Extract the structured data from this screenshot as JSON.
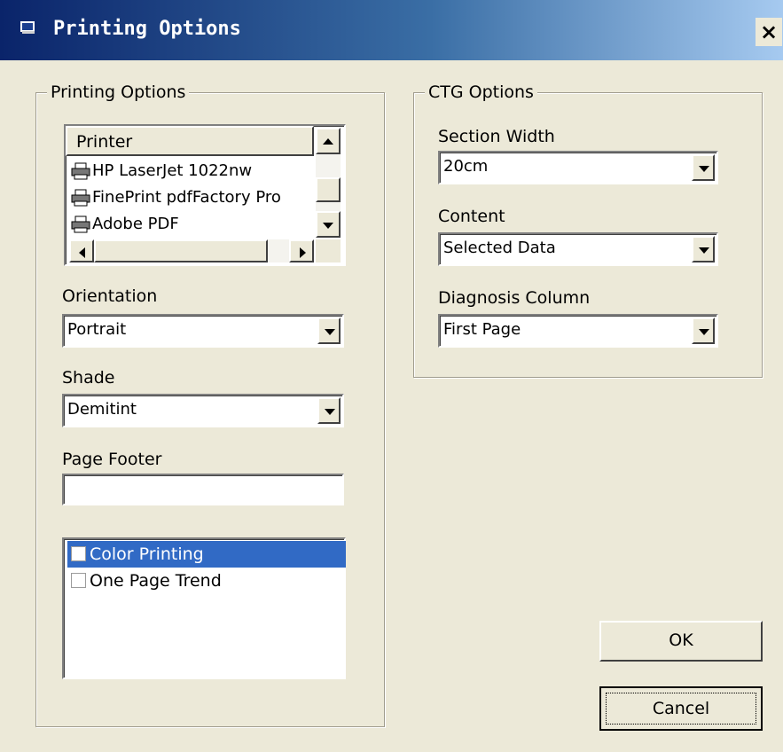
{
  "window": {
    "title": "Printing Options",
    "close_glyph": "×"
  },
  "printing_options": {
    "group_label": "Printing Options",
    "printer_list": {
      "header": "Printer",
      "items": [
        {
          "label": "HP LaserJet 1022nw",
          "icon": "printer-icon"
        },
        {
          "label": "FinePrint pdfFactory Pro",
          "icon": "printer-icon"
        },
        {
          "label": "Adobe PDF",
          "icon": "printer-icon"
        }
      ]
    },
    "orientation": {
      "label": "Orientation",
      "value": "Portrait"
    },
    "shade": {
      "label": "Shade",
      "value": "Demitint"
    },
    "page_footer": {
      "label": "Page Footer",
      "value": ""
    },
    "checklist": [
      {
        "label": "Color Printing",
        "checked": false,
        "selected": true
      },
      {
        "label": "One Page Trend",
        "checked": false,
        "selected": false
      }
    ]
  },
  "ctg_options": {
    "group_label": "CTG Options",
    "section_width": {
      "label": "Section Width",
      "value": "20cm"
    },
    "content": {
      "label": "Content",
      "value": "Selected Data"
    },
    "diagnosis_column": {
      "label": "Diagnosis Column",
      "value": "First Page"
    }
  },
  "buttons": {
    "ok": "OK",
    "cancel": "Cancel"
  },
  "colors": {
    "title_gradient_start": "#0a246a",
    "title_gradient_end": "#a6caf0",
    "selection": "#316ac5",
    "face": "#ece9d8"
  }
}
